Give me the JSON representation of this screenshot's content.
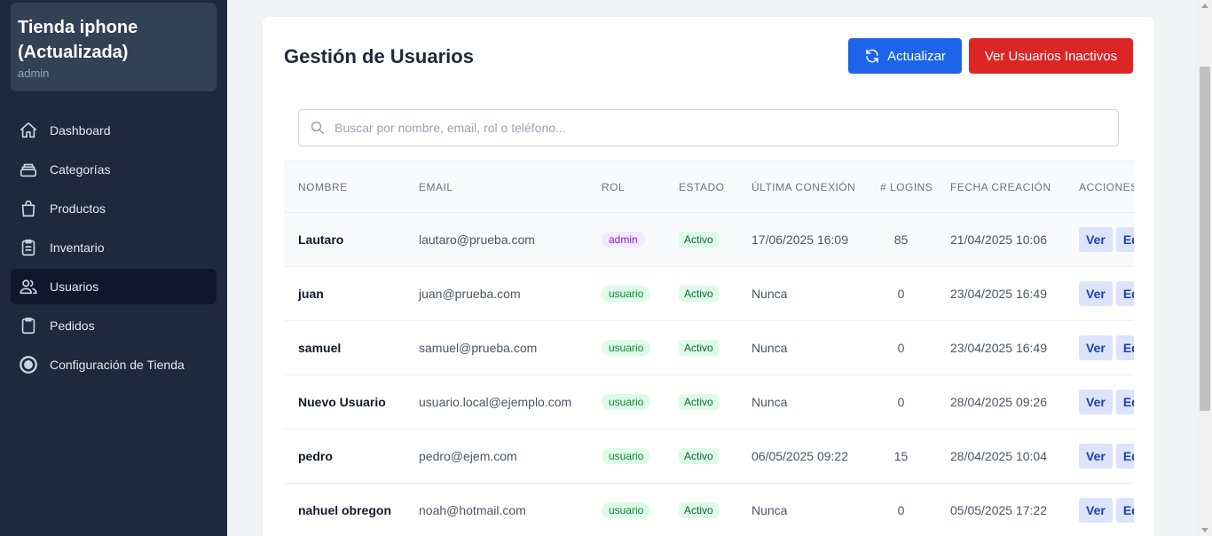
{
  "sidebar": {
    "brand_title": "Tienda iphone (Actualizada)",
    "brand_subtitle": "admin",
    "items": [
      {
        "label": "Dashboard",
        "icon": "home-icon",
        "active": false
      },
      {
        "label": "Categorías",
        "icon": "layers-icon",
        "active": false
      },
      {
        "label": "Productos",
        "icon": "shopping-bag-icon",
        "active": false
      },
      {
        "label": "Inventario",
        "icon": "clipboard-list-icon",
        "active": false
      },
      {
        "label": "Usuarios",
        "icon": "users-icon",
        "active": true
      },
      {
        "label": "Pedidos",
        "icon": "clipboard-icon",
        "active": false
      },
      {
        "label": "Configuración de Tienda",
        "icon": "settings-circle-icon",
        "active": false
      }
    ]
  },
  "main": {
    "title": "Gestión de Usuarios",
    "refresh_label": "Actualizar",
    "inactive_label": "Ver Usuarios Inactivos",
    "search_placeholder": "Buscar por nombre, email, rol o teléfono..."
  },
  "table": {
    "headers": [
      "NOMBRE",
      "EMAIL",
      "ROL",
      "ESTADO",
      "ÚLTIMA CONEXIÓN",
      "# LOGINS",
      "FECHA CREACIÓN",
      "ACCIONES"
    ],
    "rows": [
      {
        "name": "Lautaro",
        "email": "lautaro@prueba.com",
        "role": "admin",
        "status": "Activo",
        "last_login": "17/06/2025 16:09",
        "logins": "85",
        "created": "21/04/2025 10:06"
      },
      {
        "name": "juan",
        "email": "juan@prueba.com",
        "role": "usuario",
        "status": "Activo",
        "last_login": "Nunca",
        "logins": "0",
        "created": "23/04/2025 16:49"
      },
      {
        "name": "samuel",
        "email": "samuel@prueba.com",
        "role": "usuario",
        "status": "Activo",
        "last_login": "Nunca",
        "logins": "0",
        "created": "23/04/2025 16:49"
      },
      {
        "name": "Nuevo Usuario",
        "email": "usuario.local@ejemplo.com",
        "role": "usuario",
        "status": "Activo",
        "last_login": "Nunca",
        "logins": "0",
        "created": "28/04/2025 09:26"
      },
      {
        "name": "pedro",
        "email": "pedro@ejem.com",
        "role": "usuario",
        "status": "Activo",
        "last_login": "06/05/2025 09:22",
        "logins": "15",
        "created": "28/04/2025 10:04"
      },
      {
        "name": "nahuel obregon",
        "email": "noah@hotmail.com",
        "role": "usuario",
        "status": "Activo",
        "last_login": "Nunca",
        "logins": "0",
        "created": "05/05/2025 17:22"
      }
    ],
    "view_label": "Ver",
    "edit_label": "Editar"
  }
}
